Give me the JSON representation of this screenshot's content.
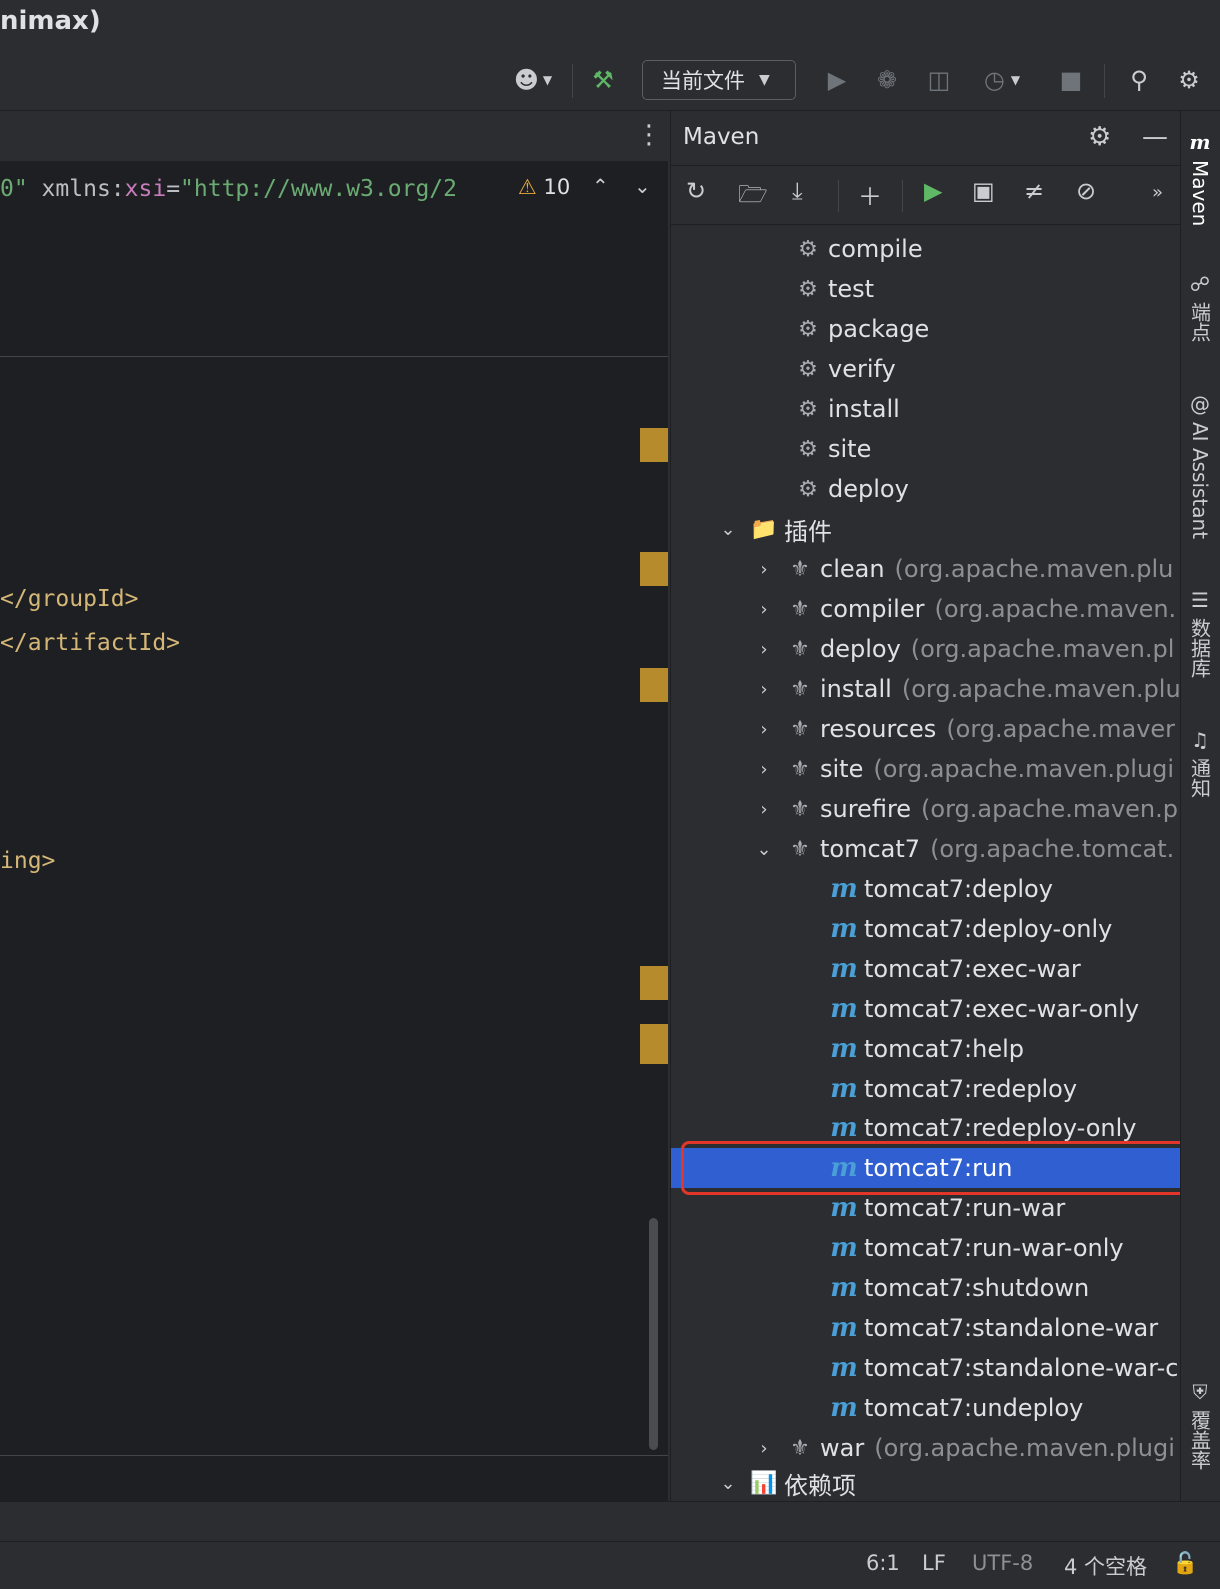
{
  "window": {
    "title_fragment": "nimax)"
  },
  "toolbar": {
    "run_config": "当前文件",
    "icons": [
      "profile-icon",
      "build-hammer-icon",
      "run-icon",
      "debug-icon",
      "coverage-icon",
      "profiler-icon",
      "stop-icon",
      "search-icon",
      "settings-icon"
    ]
  },
  "editor": {
    "line1_attr_val": "0\"",
    "line1_xmlns": " xmlns:",
    "line1_xsi": "xsi",
    "line1_eq": "=",
    "line1_url": "\"http://www.w3.org/2",
    "warning_count": "10",
    "code_groupid": "</groupId>",
    "code_artifactid": "</artifactId>",
    "code_ing": "ing>"
  },
  "maven": {
    "title": "Maven",
    "lifecycle": [
      "compile",
      "test",
      "package",
      "verify",
      "install",
      "site",
      "deploy"
    ],
    "plugins_label": "插件",
    "plugins": [
      {
        "name": "clean",
        "group": "(org.apache.maven.plu"
      },
      {
        "name": "compiler",
        "group": "(org.apache.maven."
      },
      {
        "name": "deploy",
        "group": "(org.apache.maven.pl"
      },
      {
        "name": "install",
        "group": "(org.apache.maven.plu"
      },
      {
        "name": "resources",
        "group": "(org.apache.maver"
      },
      {
        "name": "site",
        "group": "(org.apache.maven.plugi"
      },
      {
        "name": "surefire",
        "group": "(org.apache.maven.p"
      },
      {
        "name": "tomcat7",
        "group": "(org.apache.tomcat."
      }
    ],
    "tomcat_goals": [
      "tomcat7:deploy",
      "tomcat7:deploy-only",
      "tomcat7:exec-war",
      "tomcat7:exec-war-only",
      "tomcat7:help",
      "tomcat7:redeploy",
      "tomcat7:redeploy-only",
      "tomcat7:run",
      "tomcat7:run-war",
      "tomcat7:run-war-only",
      "tomcat7:shutdown",
      "tomcat7:standalone-war",
      "tomcat7:standalone-war-c",
      "tomcat7:undeploy"
    ],
    "war_plugin": {
      "name": "war",
      "group": "(org.apache.maven.plugi"
    },
    "dependencies_label": "依赖项"
  },
  "sidebar": {
    "maven": "Maven",
    "endpoints": "端点",
    "ai": "AI Assistant",
    "database": "数据库",
    "notifications": "通知",
    "coverage": "覆盖率"
  },
  "status": {
    "position": "6:1",
    "line_sep": "LF",
    "encoding": "UTF-8",
    "indent": "4 个空格"
  }
}
